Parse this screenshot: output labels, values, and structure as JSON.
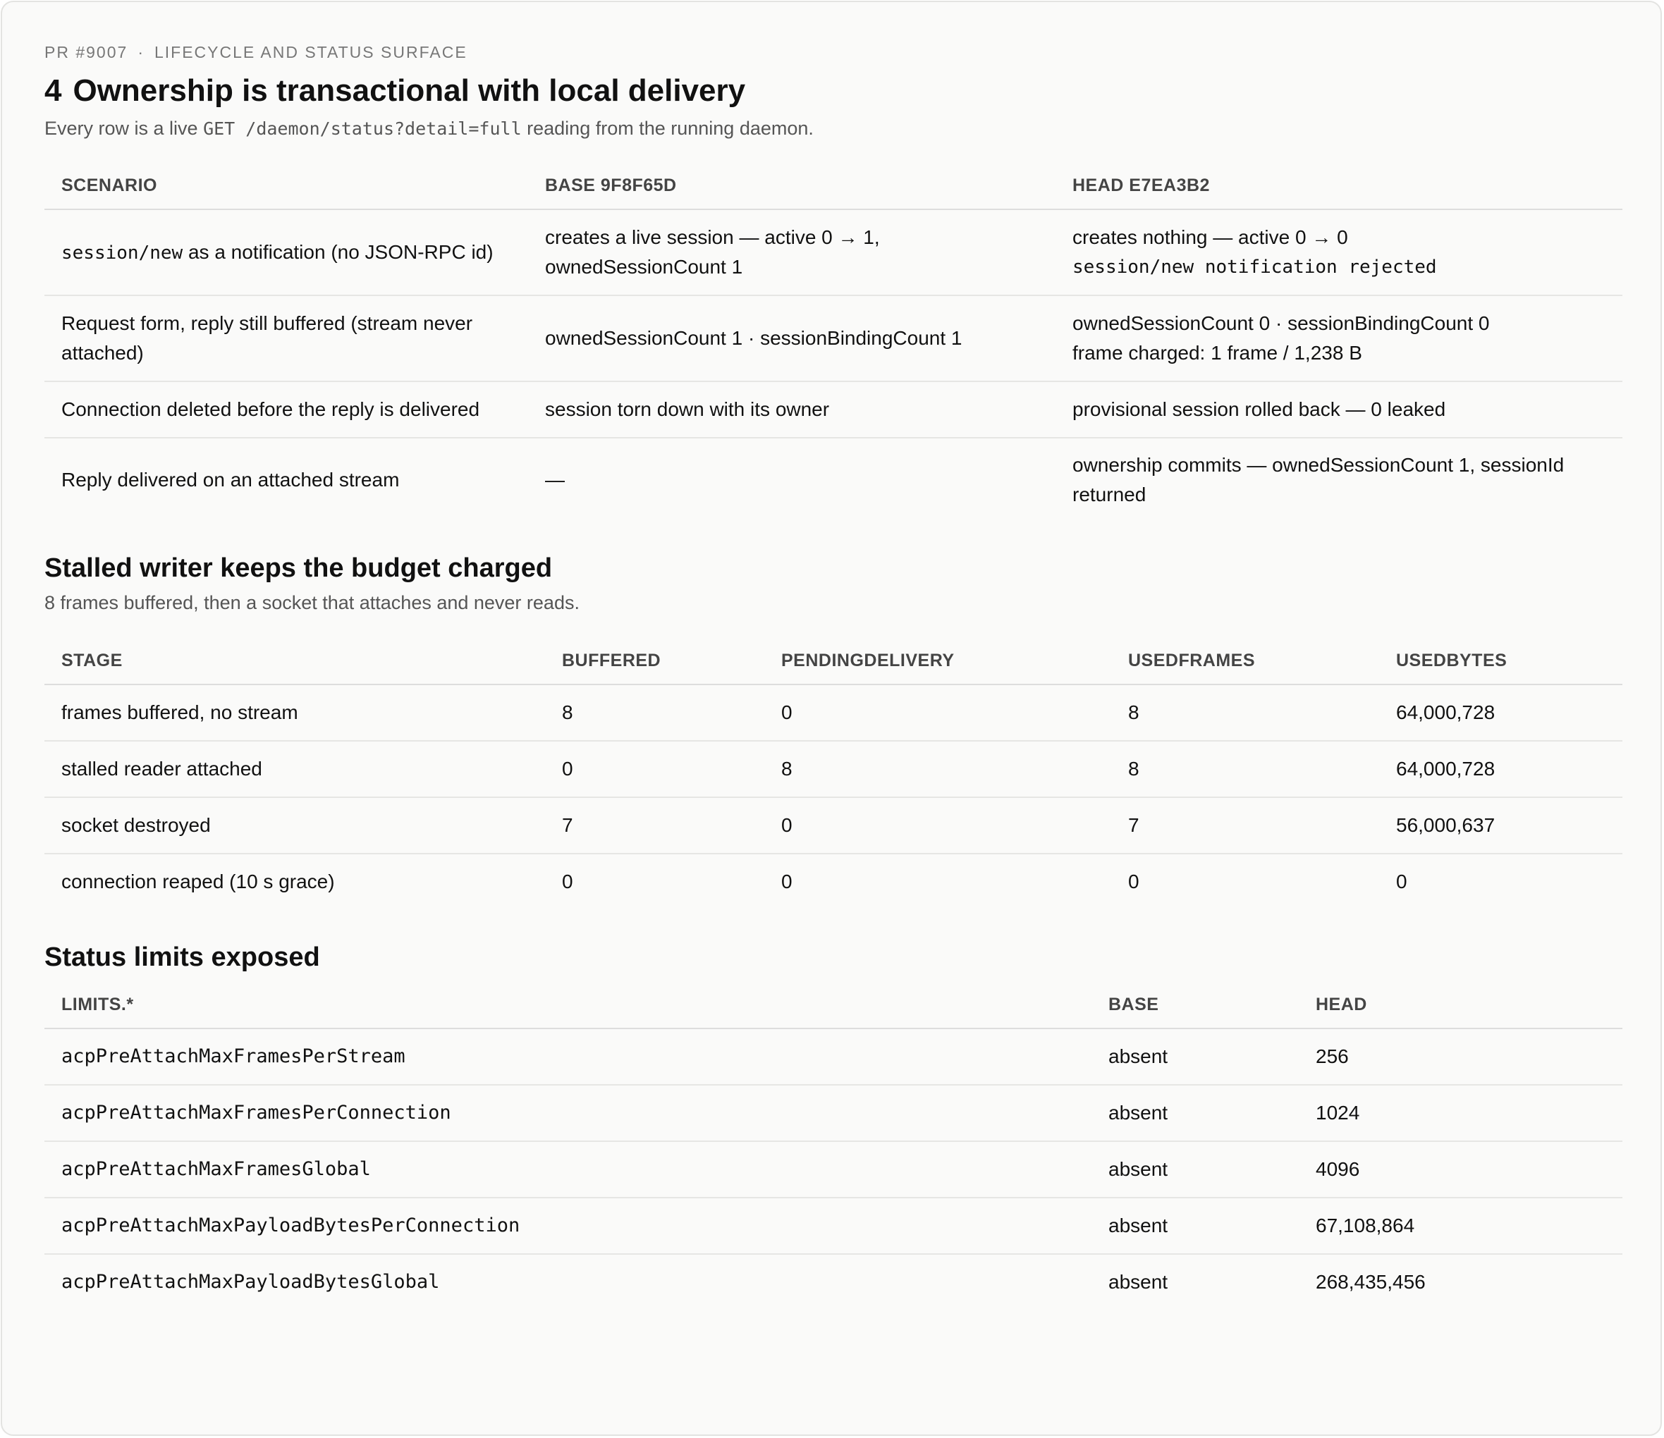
{
  "header": {
    "pr": "PR #9007",
    "separator": "·",
    "section": "LIFECYCLE AND STATUS SURFACE",
    "number": "4",
    "title": "Ownership is transactional with local delivery",
    "subtitle_pre": "Every row is a live",
    "subtitle_code": "GET /daemon/status?detail=full",
    "subtitle_post": "reading from the running daemon."
  },
  "scenarios": {
    "columns": [
      "SCENARIO",
      "BASE 9F8F65D",
      "HEAD E7EA3B2"
    ],
    "rows": [
      {
        "scenario_code": "session/new",
        "scenario": "as a notification (no JSON-RPC id)",
        "base": "creates a live session — active 0 → 1, ownedSessionCount 1",
        "head_line1": "creates nothing — active 0 → 0",
        "head_line2": "session/new notification rejected"
      },
      {
        "scenario": "Request form, reply still buffered (stream never attached)",
        "base": "ownedSessionCount 1 · sessionBindingCount 1",
        "head_line1": "ownedSessionCount 0 · sessionBindingCount 0",
        "head_line2": "frame charged: 1 frame / 1,238 B"
      },
      {
        "scenario": "Connection deleted before the reply is delivered",
        "base": "session torn down with its owner",
        "head_line1": "provisional session rolled back — 0 leaked"
      },
      {
        "scenario": "Reply delivered on an attached stream",
        "base": "—",
        "head_line1": "ownership commits — ownedSessionCount 1, sessionId returned"
      }
    ]
  },
  "stalled": {
    "title": "Stalled writer keeps the budget charged",
    "subtitle": "8 frames buffered, then a socket that attaches and never reads.",
    "columns": [
      "STAGE",
      "BUFFERED",
      "PENDINGDELIVERY",
      "USEDFRAMES",
      "USEDBYTES"
    ],
    "rows": [
      [
        "frames buffered, no stream",
        "8",
        "0",
        "8",
        "64,000,728"
      ],
      [
        "stalled reader attached",
        "0",
        "8",
        "8",
        "64,000,728"
      ],
      [
        "socket destroyed",
        "7",
        "0",
        "7",
        "56,000,637"
      ],
      [
        "connection reaped (10 s grace)",
        "0",
        "0",
        "0",
        "0"
      ]
    ]
  },
  "limits": {
    "title": "Status limits exposed",
    "columns": [
      "LIMITS.*",
      "BASE",
      "HEAD"
    ],
    "rows": [
      [
        "acpPreAttachMaxFramesPerStream",
        "absent",
        "256"
      ],
      [
        "acpPreAttachMaxFramesPerConnection",
        "absent",
        "1024"
      ],
      [
        "acpPreAttachMaxFramesGlobal",
        "absent",
        "4096"
      ],
      [
        "acpPreAttachMaxPayloadBytesPerConnection",
        "absent",
        "67,108,864"
      ],
      [
        "acpPreAttachMaxPayloadBytesGlobal",
        "absent",
        "268,435,456"
      ]
    ]
  }
}
